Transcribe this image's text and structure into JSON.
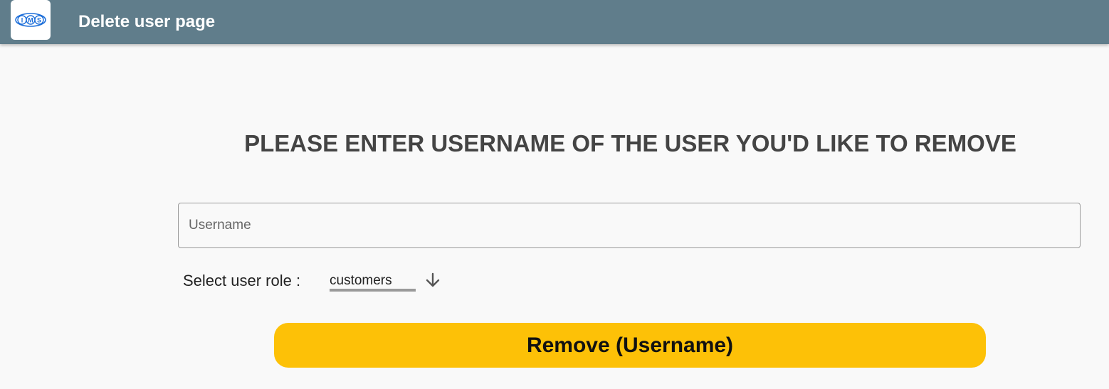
{
  "appbar": {
    "logo_text": "IMS",
    "title": "Delete user page"
  },
  "main": {
    "heading": "PLEASE ENTER USERNAME OF THE USER YOU'D LIKE TO REMOVE",
    "username_field": {
      "placeholder": "Username",
      "value": ""
    },
    "role": {
      "label": "Select user role :",
      "selected": "customers"
    },
    "remove_button_label": "Remove (Username)"
  },
  "colors": {
    "appbar": "#607d8b",
    "background": "#f9f9f9",
    "accent_button": "#fdc107",
    "logo_blue": "#1e6fd9"
  },
  "icons": {
    "logo": "ims-logo-icon",
    "dropdown": "arrow-down-icon"
  }
}
